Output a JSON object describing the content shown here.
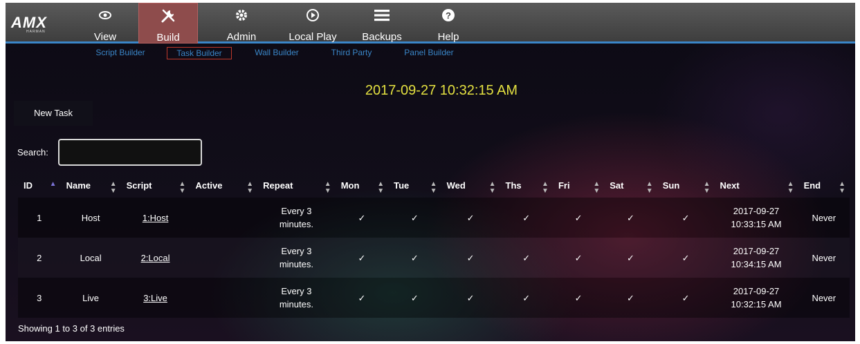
{
  "brand": {
    "logo_text": "AMX",
    "logo_sub": "HARMAN"
  },
  "nav": {
    "items": [
      {
        "label": "View",
        "icon": "eye-icon"
      },
      {
        "label": "Build",
        "icon": "tools-icon",
        "active": true
      },
      {
        "label": "Admin",
        "icon": "gear-icon"
      },
      {
        "label": "Local Play",
        "icon": "play-circle-icon"
      },
      {
        "label": "Backups",
        "icon": "hamburger-icon"
      },
      {
        "label": "Help",
        "icon": "help-circle-icon"
      }
    ],
    "accent": "#3a86c8"
  },
  "subnav": {
    "items": [
      {
        "label": "Script Builder"
      },
      {
        "label": "Task Builder",
        "active": true
      },
      {
        "label": "Wall Builder"
      },
      {
        "label": "Third Party"
      },
      {
        "label": "Panel Builder"
      }
    ]
  },
  "clock": "2017-09-27 10:32:15 AM",
  "actions": {
    "new_task": "New Task"
  },
  "search": {
    "label": "Search:",
    "value": ""
  },
  "table": {
    "columns": [
      "ID",
      "Name",
      "Script",
      "Active",
      "Repeat",
      "Mon",
      "Tue",
      "Wed",
      "Ths",
      "Fri",
      "Sat",
      "Sun",
      "Next",
      "End"
    ],
    "rows": [
      {
        "id": "1",
        "name": "Host",
        "script": "1:Host",
        "active": "",
        "repeat_1": "Every 3",
        "repeat_2": "minutes.",
        "mon": "✓",
        "tue": "✓",
        "wed": "✓",
        "ths": "✓",
        "fri": "✓",
        "sat": "✓",
        "sun": "✓",
        "next_1": "2017-09-27",
        "next_2": "10:33:15 AM",
        "end": "Never"
      },
      {
        "id": "2",
        "name": "Local",
        "script": "2:Local",
        "active": "",
        "repeat_1": "Every 3",
        "repeat_2": "minutes.",
        "mon": "✓",
        "tue": "✓",
        "wed": "✓",
        "ths": "✓",
        "fri": "✓",
        "sat": "✓",
        "sun": "✓",
        "next_1": "2017-09-27",
        "next_2": "10:34:15 AM",
        "end": "Never"
      },
      {
        "id": "3",
        "name": "Live",
        "script": "3:Live",
        "active": "",
        "repeat_1": "Every 3",
        "repeat_2": "minutes.",
        "mon": "✓",
        "tue": "✓",
        "wed": "✓",
        "ths": "✓",
        "fri": "✓",
        "sat": "✓",
        "sun": "✓",
        "next_1": "2017-09-27",
        "next_2": "10:32:15 AM",
        "end": "Never"
      }
    ]
  },
  "footer": "Showing 1 to 3 of 3 entries"
}
